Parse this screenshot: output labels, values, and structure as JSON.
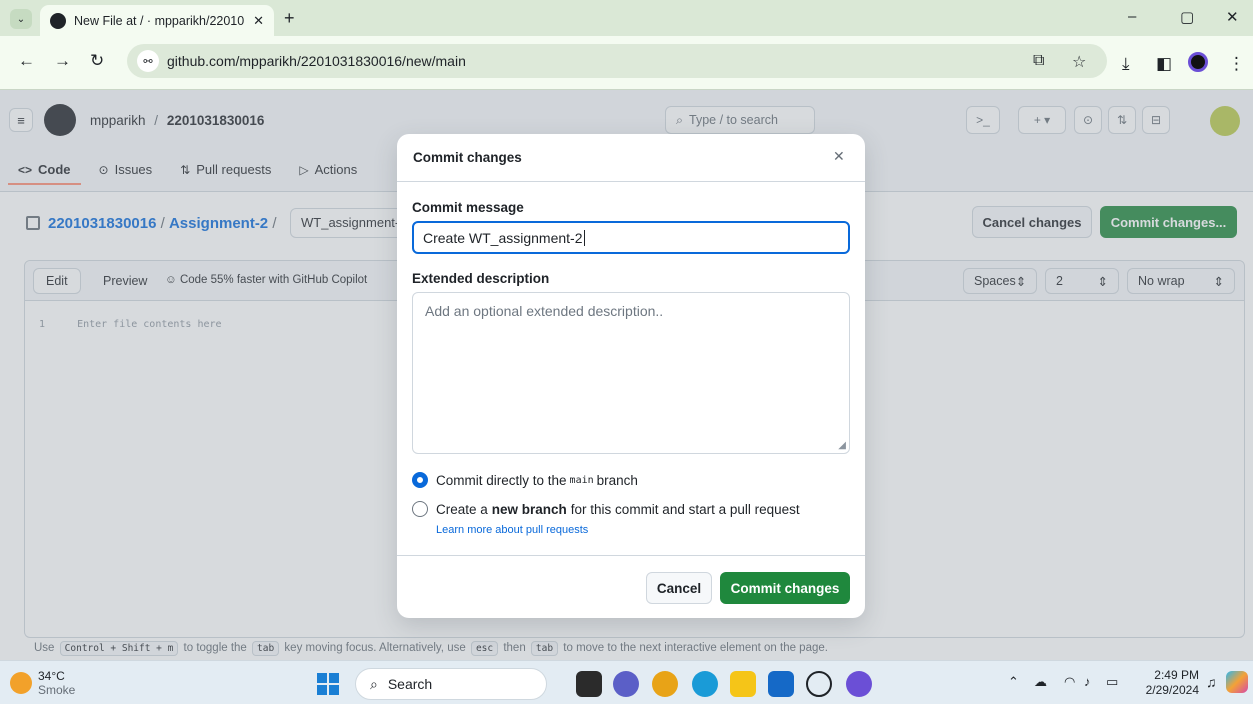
{
  "browser": {
    "tab_title": "New File at / · mpparikh/22010",
    "url": "github.com/mpparikh/2201031830016/new/main",
    "icons": {
      "tab_dropdown": "chevron-down-icon",
      "new_tab": "+",
      "minimize": "–",
      "restore": "▢",
      "close": "✕",
      "back": "←",
      "forward": "→",
      "reload": "↻",
      "tune": "⚯",
      "install": "⧉",
      "star": "☆",
      "download": "⤓",
      "sidepanel": "◧",
      "menu": "⋮"
    }
  },
  "github": {
    "owner": "mpparikh",
    "separator": "/",
    "repo": "2201031830016",
    "search_placeholder": "Type / to search",
    "nav": [
      {
        "label": "Code",
        "icon": "<>"
      },
      {
        "label": "Issues",
        "icon": "⊙"
      },
      {
        "label": "Pull requests",
        "icon": "⇅"
      },
      {
        "label": "Actions",
        "icon": "▷"
      }
    ],
    "breadcrumb_repo": "2201031830016",
    "breadcrumb_folder": "Assignment-2",
    "breadcrumb_sep": "/",
    "filename": "WT_assignment-2",
    "cancel_changes": "Cancel changes",
    "commit_changes_top": "Commit changes...",
    "editor": {
      "tab_edit": "Edit",
      "tab_preview": "Preview",
      "copilot": "Code 55% faster with GitHub Copilot",
      "indent_mode": "Spaces",
      "indent_size": "2",
      "wrap_mode": "No wrap",
      "line_number": "1",
      "placeholder": "Enter file contents here"
    },
    "hint": {
      "use": "Use",
      "keys": "Control + Shift + m",
      "to_toggle": "to toggle the",
      "tab": "tab",
      "moving": "key moving focus. Alternatively, use",
      "esc": "esc",
      "then": "then",
      "tab2": "tab",
      "rest": "to move to the next interactive element on the page."
    }
  },
  "dialog": {
    "title": "Commit changes",
    "close_icon": "✕",
    "commit_message_label": "Commit message",
    "commit_message_value": "Create WT_assignment-2",
    "extended_label": "Extended description",
    "extended_placeholder": "Add an optional extended description..",
    "option_direct_prefix": "Commit directly to the",
    "option_direct_branch": "main",
    "option_direct_suffix": "branch",
    "option_new_prefix": "Create a",
    "option_new_bold": "new branch",
    "option_new_suffix": "for this commit and start a pull request",
    "learn_more": "Learn more about pull requests",
    "cancel": "Cancel",
    "commit": "Commit changes"
  },
  "taskbar": {
    "temperature": "34°C",
    "condition": "Smoke",
    "search": "Search",
    "time": "2:49 PM",
    "date": "2/29/2024"
  }
}
